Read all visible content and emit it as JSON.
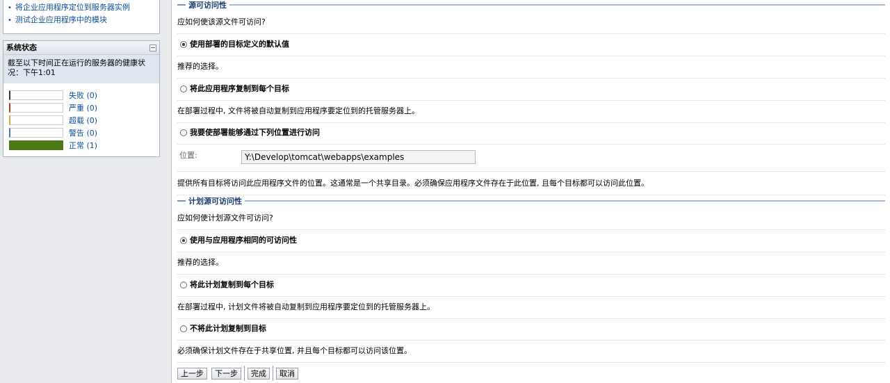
{
  "sidebar": {
    "help_links": [
      "将企业应用程序定位到服务器实例",
      "测试企业应用程序中的模块"
    ],
    "system_status": {
      "title": "系统状态",
      "description": "截至以下时间正在运行的服务器的健康状况：下午1:01",
      "health": [
        {
          "label": "失败 (0)",
          "count": 0
        },
        {
          "label": "严重 (0)",
          "count": 0
        },
        {
          "label": "超载 (0)",
          "count": 0
        },
        {
          "label": "警告 (0)",
          "count": 0
        },
        {
          "label": "正常 (1)",
          "count": 1
        }
      ],
      "colors": {
        "fail": "#333333",
        "critical": "#c0392b",
        "overloaded": "#e0a43a",
        "warning": "#4a7ab8",
        "ok": "#4d7a17"
      }
    }
  },
  "source_access": {
    "title": "源可访问性",
    "question": "应如何使该源文件可访问?",
    "option1": "使用部署的目标定义的默认值",
    "option1_desc": "推荐的选择。",
    "option2": "将此应用程序复制到每个目标",
    "option2_desc": "在部署过程中, 文件将被自动复制到应用程序要定位到的托管服务器上。",
    "option3": "我要使部署能够通过下列位置进行访问",
    "location_label": "位置:",
    "location_value": "Y:\\Develop\\tomcat\\webapps\\examples",
    "location_desc": "提供所有目标将访问此应用程序文件的位置。这通常是一个共享目录。必须确保应用程序文件存在于此位置, 且每个目标都可以访问此位置。"
  },
  "plan_access": {
    "title": "计划源可访问性",
    "question": "应如何使计划源文件可访问?",
    "option1": "使用与应用程序相同的可访问性",
    "option1_desc": "推荐的选择。",
    "option2": "将此计划复制到每个目标",
    "option2_desc": "在部署过程中, 计划文件将被自动复制到应用程序要定位到的托管服务器上。",
    "option3": "不将此计划复制到目标",
    "option3_desc": "必须确保计划文件存在于共享位置, 并且每个目标都可以访问该位置。"
  },
  "buttons": {
    "back": "上一步",
    "next": "下一步",
    "finish": "完成",
    "cancel": "取消"
  }
}
